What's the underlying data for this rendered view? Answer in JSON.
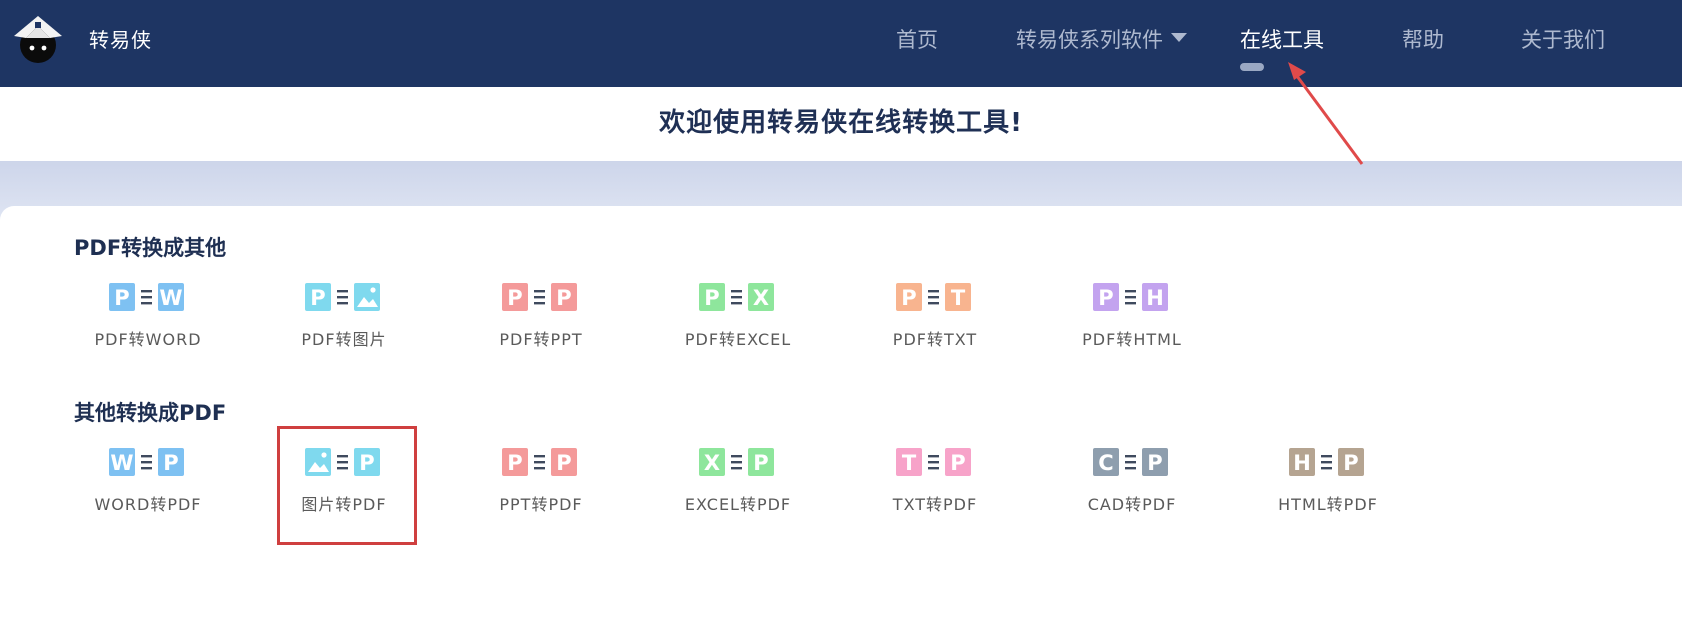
{
  "brand": {
    "name": "转易侠"
  },
  "nav": {
    "items": [
      {
        "label": "首页"
      },
      {
        "label": "转易侠系列软件"
      },
      {
        "label": "在线工具"
      },
      {
        "label": "帮助"
      },
      {
        "label": "关于我们"
      }
    ],
    "active_index": 2
  },
  "welcome": {
    "title": "欢迎使用转易侠在线转换工具!"
  },
  "sections": [
    {
      "title": "PDF转换成其他",
      "tools": [
        {
          "label": "PDF转WORD",
          "from": "P",
          "to": "W",
          "from_color": "#7ec1f2",
          "to_color": "#7ec1f2"
        },
        {
          "label": "PDF转图片",
          "from": "P",
          "to": "image-icon",
          "from_color": "#7fd9ee",
          "to_color": "#7fd9ee"
        },
        {
          "label": "PDF转PPT",
          "from": "P",
          "to": "P",
          "from_color": "#f49a9a",
          "to_color": "#f49a9a"
        },
        {
          "label": "PDF转EXCEL",
          "from": "P",
          "to": "X",
          "from_color": "#8ee69c",
          "to_color": "#8ee69c"
        },
        {
          "label": "PDF转TXT",
          "from": "P",
          "to": "T",
          "from_color": "#f8b48f",
          "to_color": "#f8b48f"
        },
        {
          "label": "PDF转HTML",
          "from": "P",
          "to": "H",
          "from_color": "#c3a3ef",
          "to_color": "#c3a3ef"
        }
      ]
    },
    {
      "title": "其他转换成PDF",
      "tools": [
        {
          "label": "WORD转PDF",
          "from": "W",
          "to": "P",
          "from_color": "#7ec1f2",
          "to_color": "#7ec1f2"
        },
        {
          "label": "图片转PDF",
          "from": "image-icon",
          "to": "P",
          "from_color": "#7fd9ee",
          "to_color": "#7fd9ee"
        },
        {
          "label": "PPT转PDF",
          "from": "P",
          "to": "P",
          "from_color": "#f49a9a",
          "to_color": "#f49a9a"
        },
        {
          "label": "EXCEL转PDF",
          "from": "X",
          "to": "P",
          "from_color": "#8ee69c",
          "to_color": "#8ee69c"
        },
        {
          "label": "TXT转PDF",
          "from": "T",
          "to": "P",
          "from_color": "#f7a3c9",
          "to_color": "#f7a3c9"
        },
        {
          "label": "CAD转PDF",
          "from": "C",
          "to": "P",
          "from_color": "#8e9eae",
          "to_color": "#8e9eae"
        },
        {
          "label": "HTML转PDF",
          "from": "H",
          "to": "P",
          "from_color": "#b5a491",
          "to_color": "#b5a491"
        }
      ]
    }
  ],
  "highlighted_tool": "图片转PDF",
  "colors": {
    "header_bg": "#1e3563",
    "highlight": "#cf3f3f",
    "arrow": "#e04a4a"
  }
}
